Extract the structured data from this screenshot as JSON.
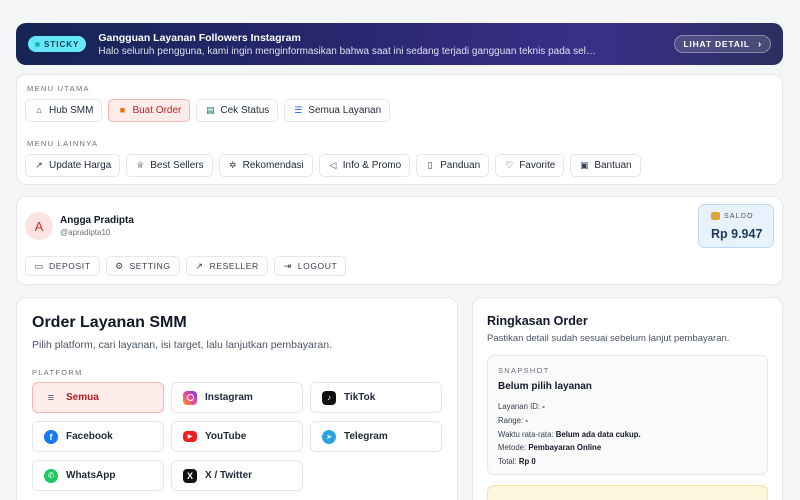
{
  "banner": {
    "badge": "STICKY",
    "title": "Gangguan Layanan Followers Instagram",
    "message": "Halo seluruh pengguna, kami ingin menginformasikan bahwa saat ini sedang terjadi gangguan teknis pada seluruh layanan Followers Instagram.",
    "detail_button": "LIHAT DETAIL"
  },
  "menu_utama": {
    "label": "MENU UTAMA",
    "items": [
      {
        "label": "Hub SMM",
        "icon": "home-icon"
      },
      {
        "label": "Buat Order",
        "icon": "cart-icon",
        "active": true
      },
      {
        "label": "Cek Status",
        "icon": "clipboard-icon"
      },
      {
        "label": "Semua Layanan",
        "icon": "list-icon"
      }
    ]
  },
  "menu_lainnya": {
    "label": "MENU LAINNYA",
    "items": [
      {
        "label": "Update Harga",
        "icon": "trend-icon"
      },
      {
        "label": "Best Sellers",
        "icon": "trophy-icon"
      },
      {
        "label": "Rekomendasi",
        "icon": "sparkle-icon"
      },
      {
        "label": "Info & Promo",
        "icon": "megaphone-icon"
      },
      {
        "label": "Panduan",
        "icon": "document-icon"
      },
      {
        "label": "Favorite",
        "icon": "heart-icon"
      },
      {
        "label": "Bantuan",
        "icon": "help-icon"
      }
    ]
  },
  "profile": {
    "initial": "A",
    "name": "Angga Pradipta",
    "handle": "@apradipta10",
    "saldo_label": "SALDO",
    "saldo_value": "Rp 9.947",
    "actions": [
      {
        "label": "DEPOSIT",
        "icon": "wallet-icon"
      },
      {
        "label": "SETTING",
        "icon": "gear-icon"
      },
      {
        "label": "RESELLER",
        "icon": "trend-icon"
      },
      {
        "label": "LOGOUT",
        "icon": "logout-icon"
      }
    ]
  },
  "order": {
    "title": "Order Layanan SMM",
    "subtitle": "Pilih platform, cari layanan, isi target, lalu lanjutkan pembayaran.",
    "platform_label": "PLATFORM",
    "platforms": [
      {
        "label": "Semua",
        "icon": "menu-icon",
        "active": true
      },
      {
        "label": "Instagram",
        "icon": "instagram-icon"
      },
      {
        "label": "TikTok",
        "icon": "tiktok-icon"
      },
      {
        "label": "Facebook",
        "icon": "facebook-icon"
      },
      {
        "label": "YouTube",
        "icon": "youtube-icon"
      },
      {
        "label": "Telegram",
        "icon": "telegram-icon"
      },
      {
        "label": "WhatsApp",
        "icon": "whatsapp-icon"
      },
      {
        "label": "X / Twitter",
        "icon": "x-twitter-icon"
      }
    ]
  },
  "summary": {
    "title": "Ringkasan Order",
    "subtitle": "Pastikan detail sudah sesuai sebelum lanjut pembayaran.",
    "snapshot_label": "SNAPSHOT",
    "snapshot_title": "Belum pilih layanan",
    "rows": [
      {
        "key": "Layanan ID:",
        "value": "-"
      },
      {
        "key": "Range:",
        "value": "-"
      },
      {
        "key": "Waktu rata-rata:",
        "value": "Belum ada data cukup."
      },
      {
        "key": "Metode:",
        "value": "Pembayaran Online"
      },
      {
        "key": "Total:",
        "value": "Rp 0"
      }
    ]
  },
  "colors": {
    "accent_red": "#c81e1e",
    "banner_pill": "#67e8f9",
    "saldo_bg": "#e8f2fc"
  }
}
